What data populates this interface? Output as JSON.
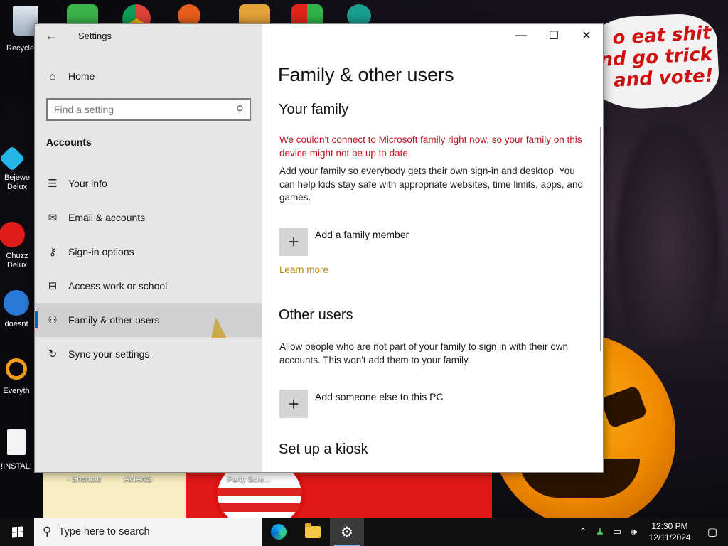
{
  "window": {
    "title": "Settings",
    "controls": {
      "minimize": "—",
      "maximize": "☐",
      "close": "✕"
    }
  },
  "nav": {
    "home": "Home",
    "search_placeholder": "Find a setting",
    "section": "Accounts",
    "items": [
      {
        "label": "Your info",
        "icon": "person-card-icon"
      },
      {
        "label": "Email & accounts",
        "icon": "mail-icon"
      },
      {
        "label": "Sign-in options",
        "icon": "key-icon"
      },
      {
        "label": "Access work or school",
        "icon": "briefcase-icon"
      },
      {
        "label": "Family & other users",
        "icon": "person-add-icon",
        "selected": true
      },
      {
        "label": "Sync your settings",
        "icon": "sync-icon"
      }
    ]
  },
  "content": {
    "title": "Family & other users",
    "family": {
      "heading": "Your family",
      "error": "We couldn't connect to Microsoft family right now, so your family on this device might not be up to date.",
      "description": "Add your family so everybody gets their own sign-in and desktop. You can help kids stay safe with appropriate websites, time limits, apps, and games.",
      "add_label": "Add a family member",
      "learn_more": "Learn more"
    },
    "other": {
      "heading": "Other users",
      "description": "Allow people who are not part of your family to sign in with their own accounts. This won't add them to your family.",
      "add_label": "Add someone else to this PC"
    },
    "kiosk": {
      "heading": "Set up a kiosk"
    }
  },
  "desktop": {
    "icons": [
      {
        "label": "Recycle"
      },
      {
        "label": "Bejewe\nDelux"
      },
      {
        "label": "Chuzz\nDelux"
      },
      {
        "label": "doesnt"
      },
      {
        "label": "Everyth"
      },
      {
        "label": "!INSTALI"
      }
    ],
    "wallpaper_text": "o eat shit\nnd go trick\nand vote!",
    "shortcut_labels": [
      "- Shortcut",
      "AVIANS",
      "Party Scre..."
    ]
  },
  "taskbar": {
    "search_placeholder": "Type here to search",
    "time": "12:30 PM",
    "date": "12/11/2024"
  }
}
